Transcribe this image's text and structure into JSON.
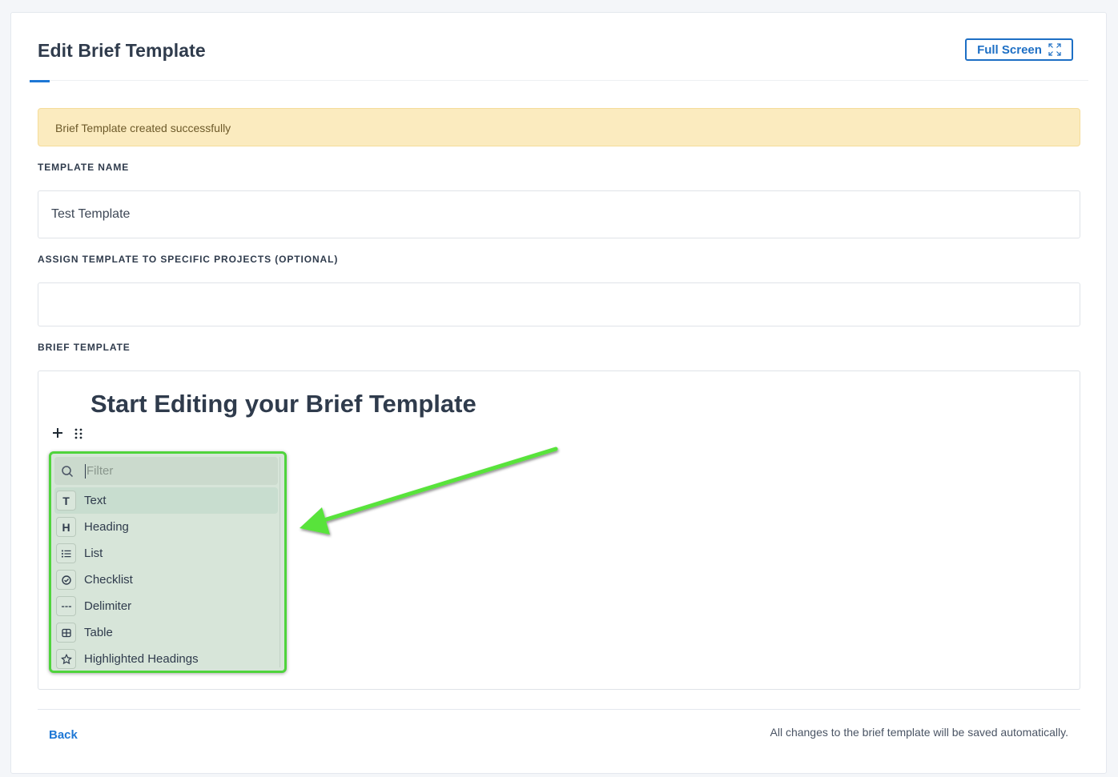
{
  "header": {
    "title": "Edit Brief Template",
    "fullscreen_label": "Full Screen"
  },
  "alert": {
    "message": "Brief Template created successfully"
  },
  "form": {
    "template_name_label": "TEMPLATE NAME",
    "template_name_value": "Test Template",
    "assign_label": "ASSIGN TEMPLATE TO SPECIFIC PROJECTS (OPTIONAL)",
    "assign_value": "",
    "brief_label": "BRIEF TEMPLATE"
  },
  "editor": {
    "heading": "Start Editing your Brief Template",
    "toolbox": {
      "filter_placeholder": "Filter",
      "items": [
        {
          "label": "Text",
          "icon": "text-icon",
          "glyph": "T"
        },
        {
          "label": "Heading",
          "icon": "heading-icon",
          "glyph": "H"
        },
        {
          "label": "List",
          "icon": "list-icon",
          "glyph": ""
        },
        {
          "label": "Checklist",
          "icon": "checklist-icon",
          "glyph": ""
        },
        {
          "label": "Delimiter",
          "icon": "delimiter-icon",
          "glyph": ""
        },
        {
          "label": "Table",
          "icon": "table-icon",
          "glyph": ""
        },
        {
          "label": "Highlighted Headings",
          "icon": "star-icon",
          "glyph": ""
        }
      ]
    }
  },
  "footer": {
    "back_label": "Back",
    "autosave_note": "All changes to the brief template will be saved automatically."
  },
  "colors": {
    "accent": "#1d77d5",
    "alert_bg": "#fbebbf",
    "highlight_green": "#4fd43c"
  }
}
